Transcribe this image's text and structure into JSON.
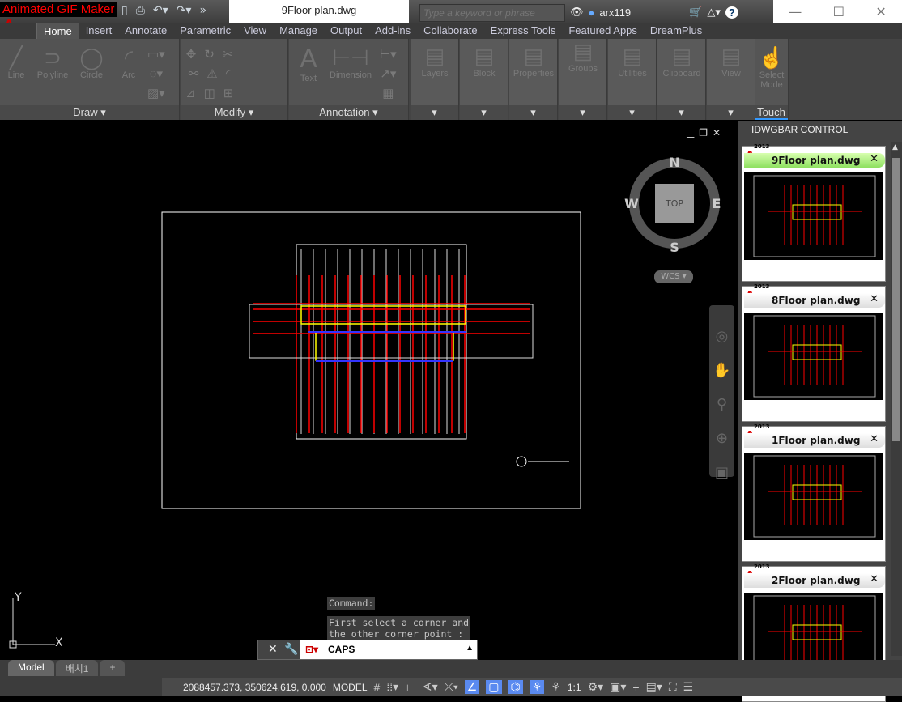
{
  "app": {
    "overlay_label": "Animated GIF Maker",
    "logo_letter": "A",
    "document_title": "9Floor plan.dwg",
    "search_placeholder": "Type a keyword or phrase",
    "username": "arx119"
  },
  "ribbon_tabs": [
    "Home",
    "Insert",
    "Annotate",
    "Parametric",
    "View",
    "Manage",
    "Output",
    "Add-ins",
    "Collaborate",
    "Express Tools",
    "Featured Apps",
    "DreamPlus"
  ],
  "ribbon_panels": {
    "draw": {
      "label": "Draw",
      "tools": [
        "Line",
        "Polyline",
        "Circle",
        "Arc"
      ]
    },
    "modify": {
      "label": "Modify"
    },
    "annotation": {
      "label": "Annotation",
      "tools": [
        "Text",
        "Dimension"
      ]
    },
    "collapsed": [
      "Layers",
      "Block",
      "Properties",
      "Groups",
      "Utilities",
      "Clipboard",
      "View"
    ],
    "touch": {
      "label": "Touch",
      "tool": "Select Mode"
    }
  },
  "viewcube": {
    "n": "N",
    "s": "S",
    "e": "E",
    "w": "W",
    "face": "TOP",
    "wcs": "WCS"
  },
  "ucs": {
    "x": "X",
    "y": "Y"
  },
  "command": {
    "history": [
      "Command:",
      "First select a corner and",
      "the other corner point :"
    ],
    "input": "CAPS"
  },
  "right_panel": {
    "title": "IDWGBAR CONTROL",
    "files": [
      {
        "name": "9Floor plan.dwg",
        "year": "2013",
        "active": true
      },
      {
        "name": "8Floor plan.dwg",
        "year": "2013",
        "active": false
      },
      {
        "name": "1Floor plan.dwg",
        "year": "2013",
        "active": false
      },
      {
        "name": "2Floor plan.dwg",
        "year": "2013",
        "active": false
      }
    ]
  },
  "layout_tabs": [
    "Model",
    "배치1",
    "+"
  ],
  "status": {
    "coords": "2088457.373, 350624.619, 0.000",
    "mode": "MODEL",
    "scale": "1:1"
  }
}
